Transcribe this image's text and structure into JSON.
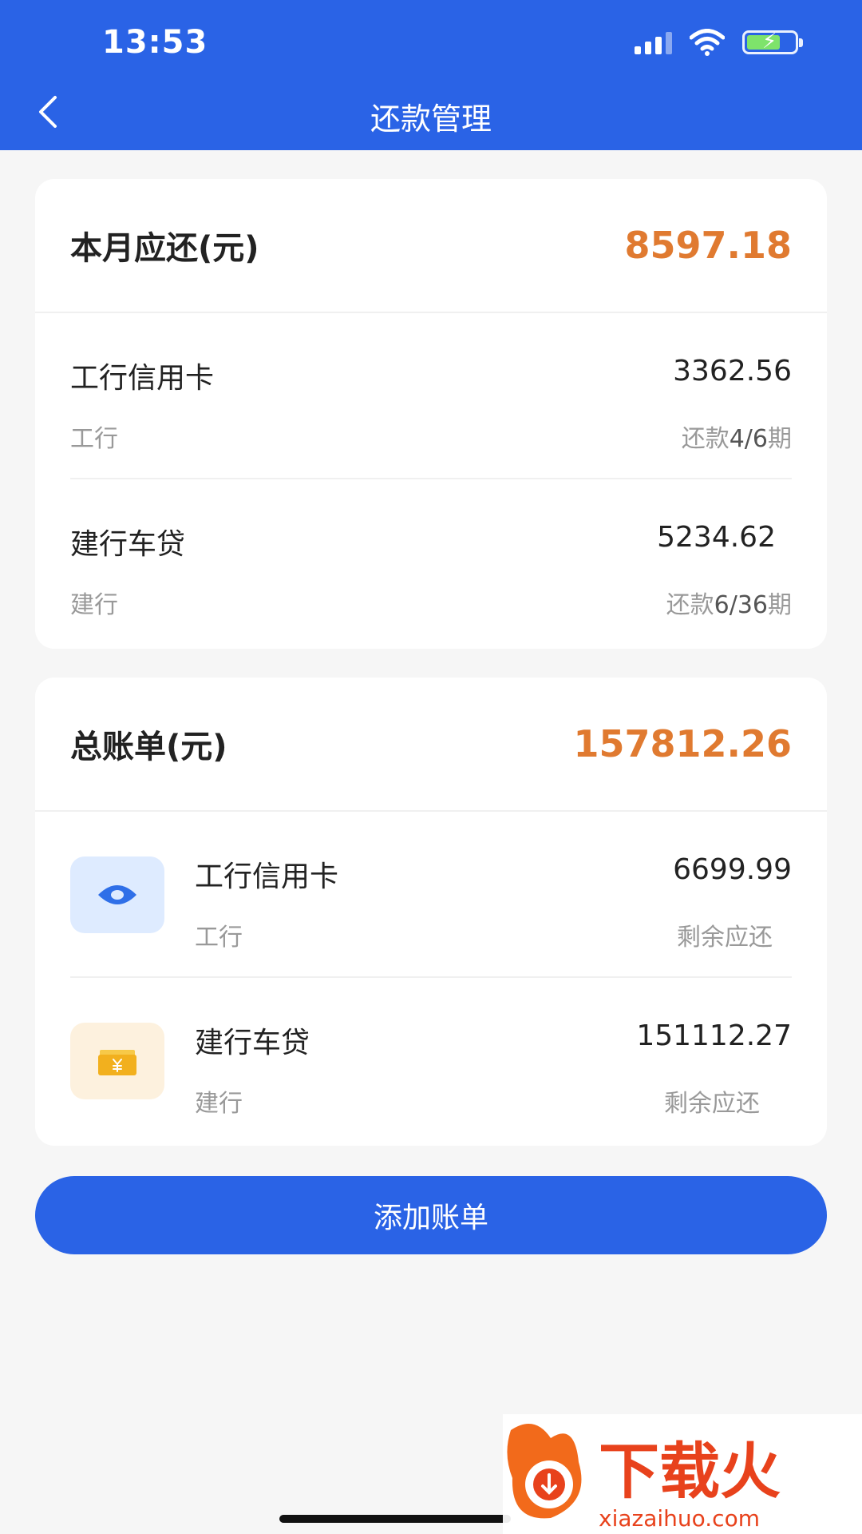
{
  "status_bar": {
    "time": "13:53"
  },
  "nav": {
    "title": "还款管理"
  },
  "monthly": {
    "label": "本月应还(元)",
    "total": "8597.18",
    "items": [
      {
        "name": "工行信用卡",
        "bank": "工行",
        "amount": "3362.56",
        "progress_prefix": "还款",
        "progress_value": "4/6",
        "progress_suffix": "期"
      },
      {
        "name": "建行车贷",
        "bank": "建行",
        "amount": "5234.62",
        "progress_prefix": "还款",
        "progress_value": "6/36",
        "progress_suffix": "期"
      }
    ]
  },
  "total_bill": {
    "label": "总账单(元)",
    "total": "157812.26",
    "items": [
      {
        "name": "工行信用卡",
        "bank": "工行",
        "amount": "6699.99",
        "note": "剩余应还",
        "icon": "eye-icon"
      },
      {
        "name": "建行车贷",
        "bank": "建行",
        "amount": "151112.27",
        "note": "剩余应还",
        "icon": "wallet-yen-icon"
      }
    ]
  },
  "actions": {
    "add_bill_label": "添加账单"
  },
  "watermark": {
    "brand": "下载火",
    "domain": "xiazaihuo.com"
  },
  "colors": {
    "primary": "#2a63e6",
    "amount_accent": "#e07a30",
    "background": "#f6f6f6"
  }
}
